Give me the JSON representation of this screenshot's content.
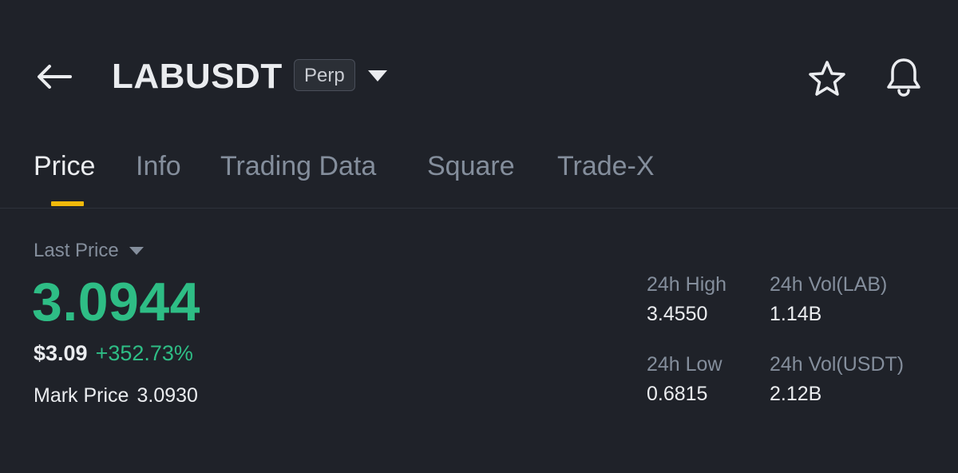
{
  "header": {
    "symbol": "LABUSDT",
    "badge": "Perp",
    "icons": [
      "back-arrow-icon",
      "caret-down-icon",
      "star-icon",
      "bell-icon"
    ]
  },
  "tabs": [
    {
      "label": "Price",
      "active": true
    },
    {
      "label": "Info",
      "active": false
    },
    {
      "label": "Trading Data",
      "active": false
    },
    {
      "label": "Square",
      "active": false
    },
    {
      "label": "Trade-X",
      "active": false
    }
  ],
  "price": {
    "last_price_label": "Last Price",
    "last_price": "3.0944",
    "usd_price": "$3.09",
    "change_pct": "+352.73%",
    "mark_label": "Mark Price",
    "mark_value": "3.0930"
  },
  "stats": {
    "high_label": "24h High",
    "high_value": "3.4550",
    "low_label": "24h Low",
    "low_value": "0.6815",
    "vol_base_label": "24h Vol(LAB)",
    "vol_base_value": "1.14B",
    "vol_quote_label": "24h Vol(USDT)",
    "vol_quote_value": "2.12B"
  },
  "colors": {
    "background": "#1f2229",
    "up_green": "#2ebd85",
    "accent_yellow": "#f0b90b",
    "muted_text": "#848e9c",
    "primary_text": "#eaecef"
  }
}
